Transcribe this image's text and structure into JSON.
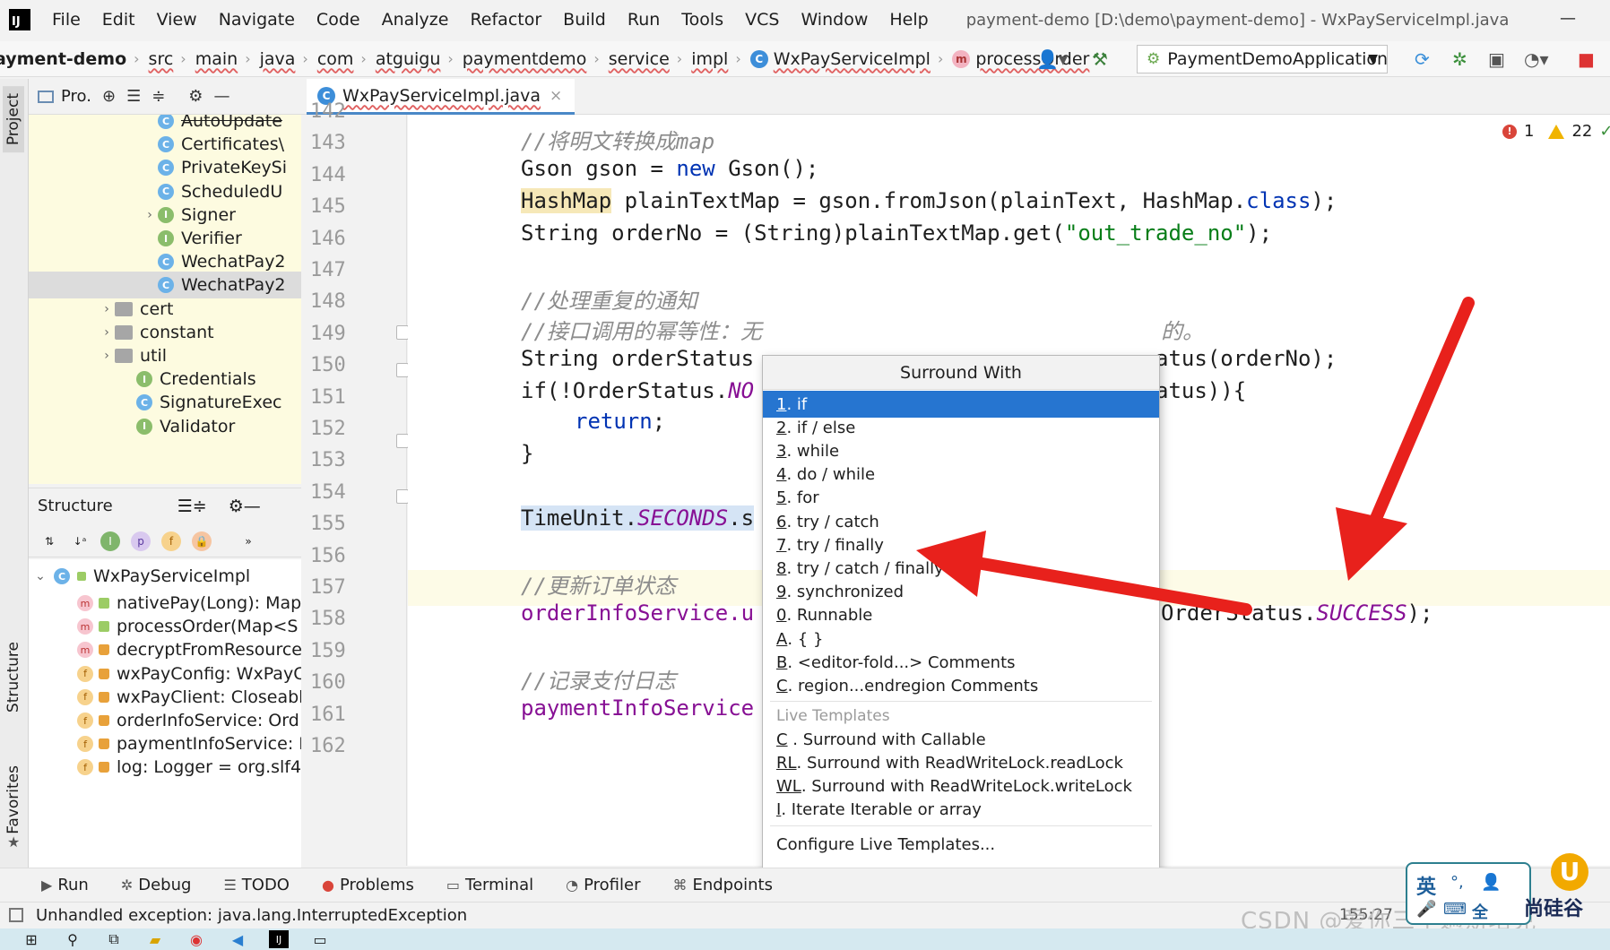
{
  "menu": {
    "logo": "IJ",
    "items": [
      "File",
      "Edit",
      "View",
      "Navigate",
      "Code",
      "Analyze",
      "Refactor",
      "Build",
      "Run",
      "Tools",
      "VCS",
      "Window",
      "Help"
    ],
    "window_title": "payment-demo [D:\\demo\\payment-demo] - WxPayServiceImpl.java",
    "minimize": "—"
  },
  "navbar": {
    "project": "ayment-demo",
    "crumbs": [
      "src",
      "main",
      "java",
      "com",
      "atguigu",
      "paymentdemo",
      "service",
      "impl",
      "WxPayServiceImpl",
      "processOrder"
    ],
    "class_icon": "C",
    "method_icon": "m",
    "run_config": "PaymentDemoApplication"
  },
  "side_tabs": {
    "project": "Project",
    "structure": "Structure",
    "favorites": "Favorites"
  },
  "project_panel": {
    "title": "Pro.",
    "items": [
      {
        "label": "AutoUpdate",
        "kind": "class",
        "strike": true
      },
      {
        "label": "Certificates\\",
        "kind": "class"
      },
      {
        "label": "PrivateKeySi",
        "kind": "class"
      },
      {
        "label": "ScheduledU",
        "kind": "class"
      },
      {
        "label": "Signer",
        "kind": "iface",
        "expandable": true
      },
      {
        "label": "Verifier",
        "kind": "iface"
      },
      {
        "label": "WechatPay2",
        "kind": "class"
      },
      {
        "label": "WechatPay2",
        "kind": "class",
        "selected": true
      },
      {
        "label": "cert",
        "kind": "folder",
        "expandable": true
      },
      {
        "label": "constant",
        "kind": "folder",
        "expandable": true
      },
      {
        "label": "util",
        "kind": "folder",
        "expandable": true
      },
      {
        "label": "Credentials",
        "kind": "iface"
      },
      {
        "label": "SignatureExec",
        "kind": "class"
      },
      {
        "label": "Validator",
        "kind": "iface"
      }
    ]
  },
  "structure_panel": {
    "title": "Structure",
    "root": "WxPayServiceImpl",
    "members": [
      {
        "label": "nativePay(Long): Map",
        "kind": "method",
        "vis": "pub"
      },
      {
        "label": "processOrder(Map<S",
        "kind": "method",
        "vis": "pub"
      },
      {
        "label": "decryptFromResource",
        "kind": "method",
        "vis": "priv"
      },
      {
        "label": "wxPayConfig: WxPayC",
        "kind": "field",
        "vis": "priv"
      },
      {
        "label": "wxPayClient: Closeabl",
        "kind": "field",
        "vis": "priv"
      },
      {
        "label": "orderInfoService: Ord",
        "kind": "field",
        "vis": "priv"
      },
      {
        "label": "paymentInfoService: I",
        "kind": "field",
        "vis": "priv"
      },
      {
        "label": "log: Logger = org.slf4",
        "kind": "field",
        "vis": "priv"
      }
    ]
  },
  "editor": {
    "tab_label": "WxPayServiceImpl.java",
    "tab_close": "×",
    "line_numbers": [
      "142",
      "143",
      "144",
      "145",
      "146",
      "147",
      "148",
      "149",
      "150",
      "151",
      "152",
      "153",
      "154",
      "155",
      "156",
      "157",
      "158",
      "159",
      "160",
      "161",
      "162"
    ],
    "code": {
      "l143": "//将明文转换成map",
      "l144_a": "Gson gson = ",
      "l144_kw": "new",
      "l144_b": " Gson();",
      "l145_a": "HashMap",
      "l145_b": " plainTextMap = gson.fromJson(plainText, HashMap.",
      "l145_kw": "class",
      "l145_c": ");",
      "l146_a": "String orderNo = (String)plainTextMap.get(",
      "l146_str": "\"out_trade_no\"",
      "l146_b": ");",
      "l148": "//处理重复的通知",
      "l149": "//接口调用的幂等性：无",
      "l149_tail": "的。",
      "l150_a": "String orderStatus",
      "l150_b": "atus(orderNo);",
      "l151_a": "if(!OrderStatus.",
      "l151_c": "NO",
      "l151_b": "atus)){",
      "l152_kw": "return",
      "l152_b": ";",
      "l153": "}",
      "l155_a": "TimeUnit.",
      "l155_c": "SECONDS",
      "l155_b": ".s",
      "l157": "//更新订单状态",
      "l158_a": "orderInfoService.u",
      "l158_b": "OrderStatus.",
      "l158_c": "SUCCESS",
      "l158_d": ");",
      "l160": "//记录支付日志",
      "l161": "paymentInfoService"
    },
    "errors": "1",
    "warnings": "22"
  },
  "popup": {
    "title": "Surround With",
    "items": [
      {
        "mn": "1",
        "rest": ". if"
      },
      {
        "mn": "2",
        "rest": ". if / else"
      },
      {
        "mn": "3",
        "rest": ". while"
      },
      {
        "mn": "4",
        "rest": ". do / while"
      },
      {
        "mn": "5",
        "rest": ". for"
      },
      {
        "mn": "6",
        "rest": ". try / catch"
      },
      {
        "mn": "7",
        "rest": ". try / finally"
      },
      {
        "mn": "8",
        "rest": ". try / catch / finally"
      },
      {
        "mn": "9",
        "rest": ". synchronized"
      },
      {
        "mn": "0",
        "rest": ". Runnable"
      },
      {
        "mn": "A",
        "rest": ". { }"
      },
      {
        "mn": "B",
        "rest": ". <editor-fold...> Comments"
      },
      {
        "mn": "C",
        "rest": ". region...endregion Comments"
      }
    ],
    "live_section": "Live Templates",
    "live_items": [
      {
        "mn": "C",
        "rest": " . Surround with Callable"
      },
      {
        "mn": "RL",
        "rest": ". Surround with ReadWriteLock.readLock"
      },
      {
        "mn": "WL",
        "rest": ". Surround with ReadWriteLock.writeLock"
      },
      {
        "mn": "I",
        "rest": ". Iterate Iterable or array"
      }
    ],
    "configure": "Configure Live Templates..."
  },
  "bottom_tools": [
    "Run",
    "Debug",
    "TODO",
    "Problems",
    "Terminal",
    "Profiler",
    "Endpoints"
  ],
  "status": {
    "message": "Unhandled exception: java.lang.InterruptedException",
    "caret": "155:27",
    "watermark": "CSDN @爱你三千遍斯塔克"
  },
  "ime": {
    "label": "英",
    "sub": "全"
  },
  "brand": {
    "text": "尚硅谷"
  },
  "colors": {
    "selection": "#2675d0",
    "arrow": "#e8211c",
    "keyword": "#0033b3",
    "string": "#067d17"
  }
}
